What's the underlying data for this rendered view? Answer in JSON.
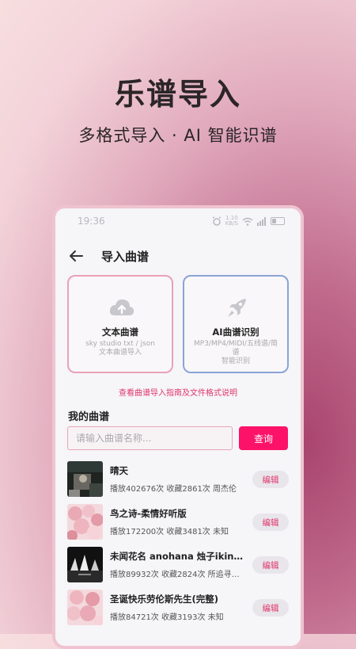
{
  "promo": {
    "headline": "乐谱导入",
    "subline": "多格式导入 · AI 智能识谱"
  },
  "status_bar": {
    "time": "19:36",
    "net_speed_top": "1.10",
    "net_speed_bottom": "KB/S"
  },
  "app_bar": {
    "title": "导入曲谱"
  },
  "import_cards": [
    {
      "title": "文本曲谱",
      "desc_1": "sky studio txt / json",
      "desc_2": "文本曲谱导入",
      "desc_3": "",
      "icon": "cloud-upload-icon",
      "border_color": "#e9a2b6"
    },
    {
      "title": "AI曲谱识别",
      "desc_1": "MP3/MP4/MIDI/五线谱/简",
      "desc_2": "谱",
      "desc_3": "智能识别",
      "icon": "rocket-icon",
      "border_color": "#8aa4d4"
    }
  ],
  "guide_link": "查看曲谱导入指南及文件格式说明",
  "my_scores": {
    "title": "我的曲谱",
    "search_placeholder": "请输入曲谱名称...",
    "search_button": "查询",
    "edit_label": "编辑",
    "items": [
      {
        "title": "晴天",
        "meta": "播放402676次  收藏2861次  周杰伦"
      },
      {
        "title": "鸟之诗-柔情好听版",
        "meta": "播放172200次  收藏3481次  未知"
      },
      {
        "title": "未闻花名 anohana 烛子ikina…",
        "meta": "播放89932次  收藏2824次  所追寻…"
      },
      {
        "title": "圣诞快乐劳伦斯先生(完整)",
        "meta": "播放84721次  收藏3193次  未知"
      }
    ]
  },
  "colors": {
    "accent": "#fd1269",
    "link": "#e0356a"
  }
}
